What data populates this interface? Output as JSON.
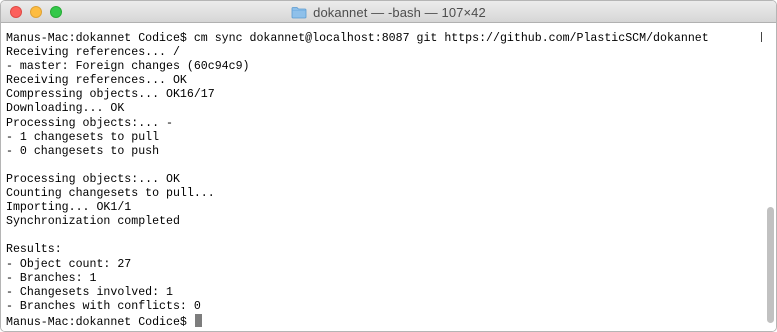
{
  "window": {
    "title": "dokannet — -bash — 107×42"
  },
  "terminal": {
    "lines": [
      "Manus-Mac:dokannet Codice$ cm sync dokannet@localhost:8087 git https://github.com/PlasticSCM/dokannet",
      "Receiving references... /",
      "- master: Foreign changes (60c94c9)",
      "Receiving references... OK",
      "Compressing objects... OK16/17",
      "Downloading... OK",
      "Processing objects:... -",
      "- 1 changesets to pull",
      "- 0 changesets to push",
      "",
      "Processing objects:... OK",
      "Counting changesets to pull...",
      "Importing... OK1/1",
      "Synchronization completed",
      "",
      "Results:",
      "- Object count: 27",
      "- Branches: 1",
      "- Changesets involved: 1",
      "- Branches with conflicts: 0"
    ],
    "prompt": "Manus-Mac:dokannet Codice$ "
  }
}
